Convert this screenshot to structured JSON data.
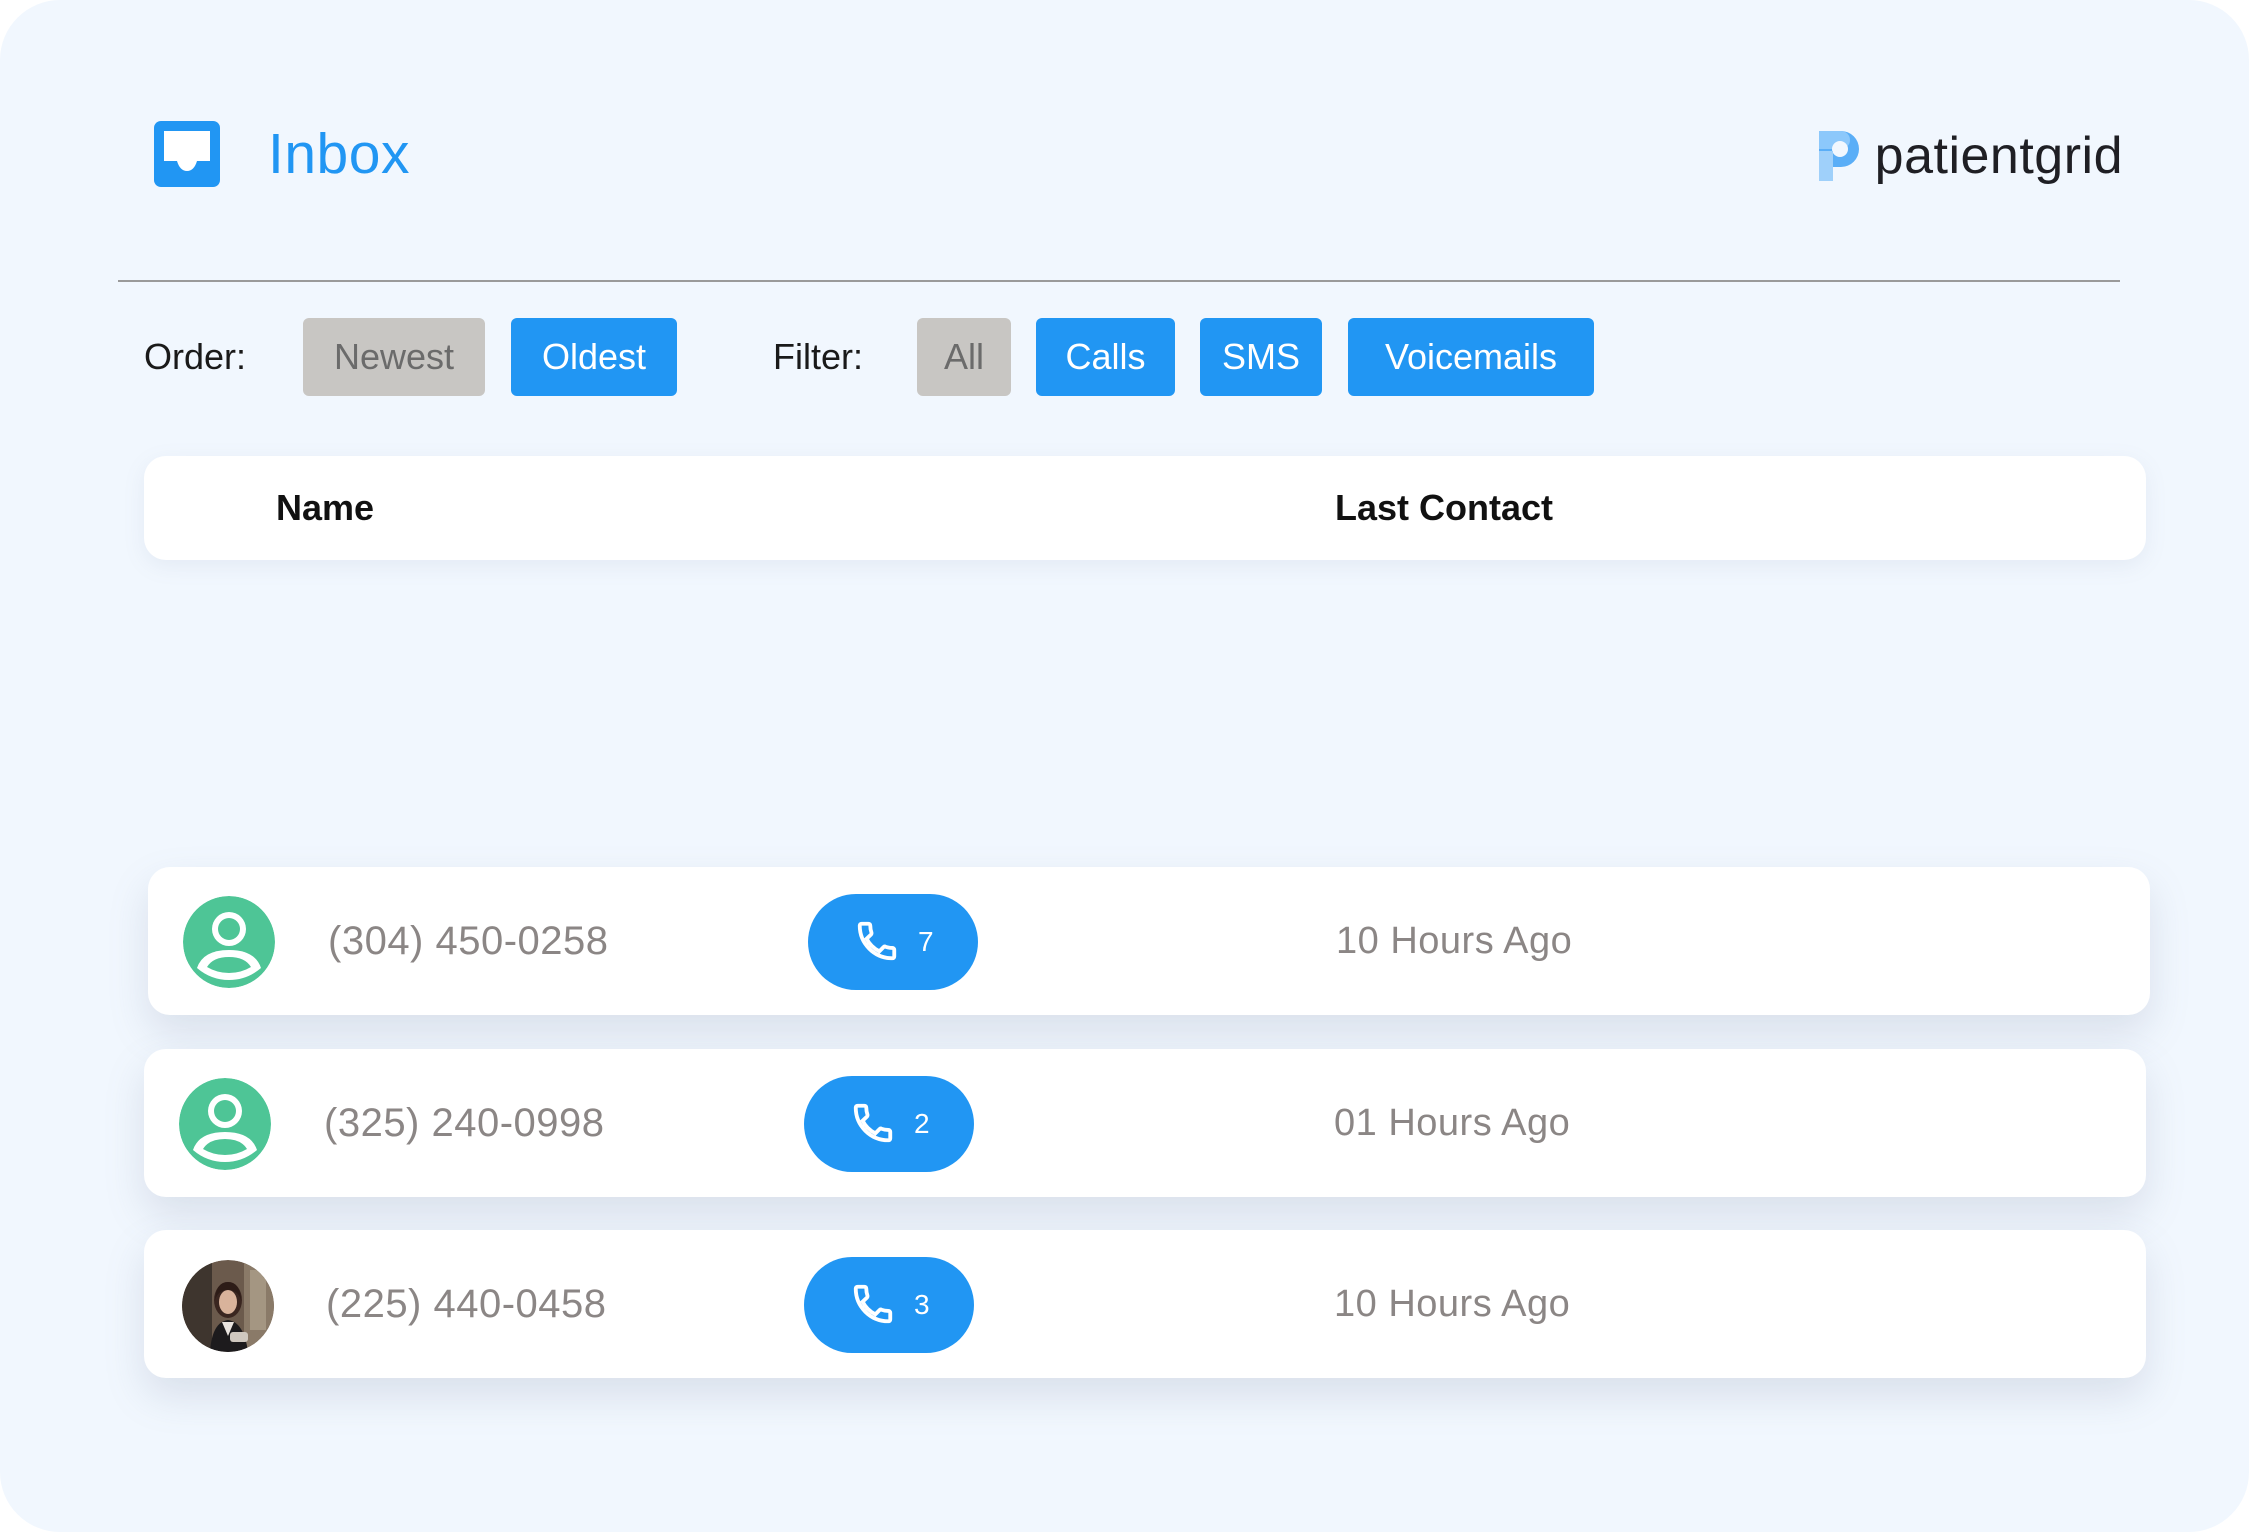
{
  "header": {
    "title": "Inbox",
    "brand_name": "patientgrid"
  },
  "controls": {
    "order_label": "Order:",
    "order_options": [
      "Newest",
      "Oldest"
    ],
    "order_selected": "Newest",
    "filter_label": "Filter:",
    "filter_options": [
      "All",
      "Calls",
      "SMS",
      "Voicemails"
    ],
    "filter_selected": "All"
  },
  "table": {
    "columns": [
      "Name",
      "Last Contact"
    ],
    "rows": [
      {
        "phone": "(304) 450-0258",
        "avatar": "default-user-icon",
        "call_count": "7",
        "last_contact": "10 Hours Ago"
      },
      {
        "phone": "(325) 240-0998",
        "avatar": "default-user-icon",
        "call_count": "2",
        "last_contact": "01 Hours Ago"
      },
      {
        "phone": "(225) 440-0458",
        "avatar": "user-photo",
        "call_count": "3",
        "last_contact": "10 Hours Ago"
      }
    ]
  },
  "colors": {
    "accent": "#2196f3",
    "muted_button": "#c8c6c3",
    "avatar_green": "#4ec596",
    "background": "#f1f7fe",
    "text_gray": "#8b8685"
  },
  "icons": {
    "inbox": "inbox-tray-icon",
    "call": "phone-icon",
    "brand": "patientgrid-logo"
  }
}
